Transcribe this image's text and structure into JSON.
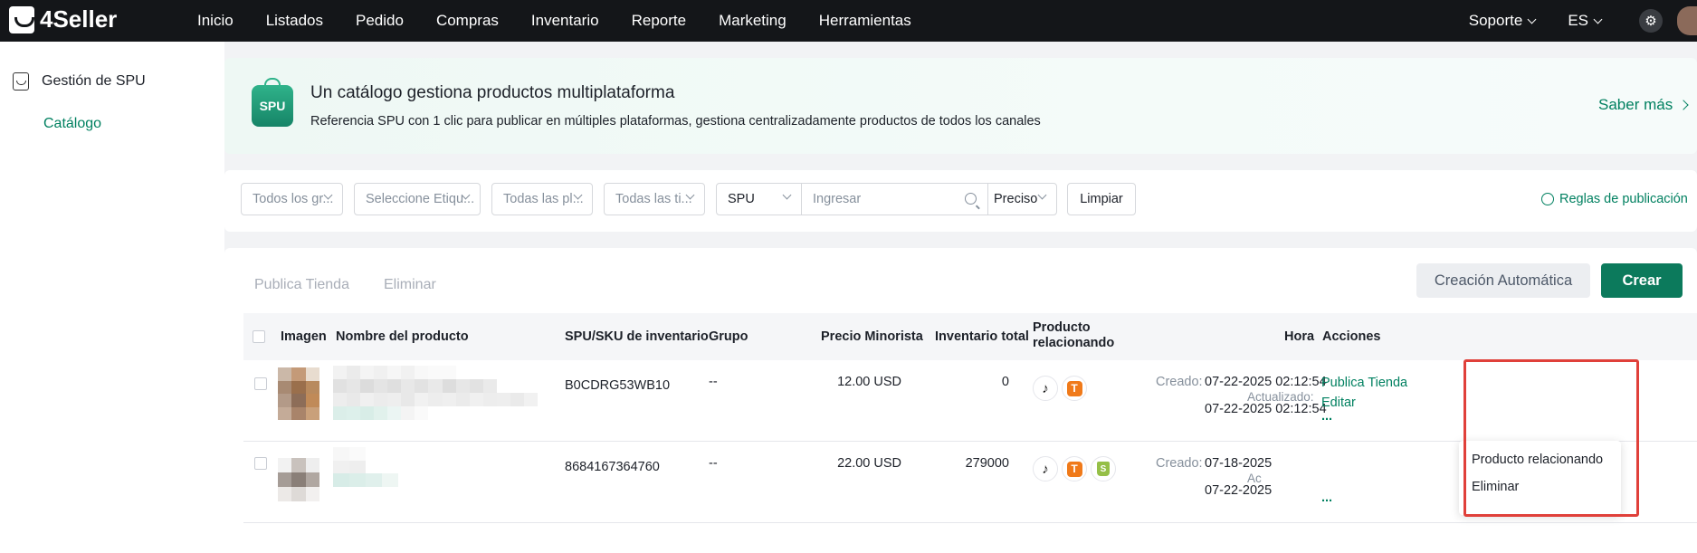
{
  "topbar": {
    "logo_text": "4Seller",
    "nav": [
      "Inicio",
      "Listados",
      "Pedido",
      "Compras",
      "Inventario",
      "Reporte",
      "Marketing",
      "Herramientas"
    ],
    "support_label": "Soporte",
    "language_label": "ES"
  },
  "sidebar": {
    "section_label": "Gestión de SPU",
    "items": [
      {
        "label": "Catálogo",
        "active": true
      }
    ]
  },
  "banner": {
    "badge": "SPU",
    "title": "Un catálogo gestiona productos multiplataforma",
    "subtitle": "Referencia SPU con 1 clic para publicar en múltiples plataformas, gestiona centralizadamente productos de todos los canales",
    "link": "Saber más"
  },
  "filters": {
    "groups_placeholder": "Todos los gr...",
    "tags_placeholder": "Seleccione Etiqu...",
    "platforms_placeholder": "Todas las pl...",
    "stores_placeholder": "Todas las ti...",
    "search_field": "SPU",
    "search_placeholder": "Ingresar",
    "match_mode": "Preciso",
    "clear_label": "Limpiar",
    "rules_label": "Reglas de publicación"
  },
  "actions": {
    "publish_store": "Publica Tienda",
    "delete": "Eliminar",
    "auto_create": "Creación Automática",
    "create": "Crear"
  },
  "table": {
    "headers": {
      "image": "Imagen",
      "name": "Nombre del producto",
      "spu_sku": "SPU/SKU de inventario",
      "group": "Grupo",
      "retail_price": "Precio Minorista",
      "total_inventory": "Inventario total",
      "related_line1": "Producto",
      "related_line2": "relacionando",
      "time": "Hora",
      "actions": "Acciones"
    },
    "rows": [
      {
        "sku": "B0CDRG53WB10",
        "group": "--",
        "price": "12.00 USD",
        "inventory": "0",
        "platforms": [
          "tiktok",
          "temu"
        ],
        "created_label": "Creado:",
        "created": "07-22-2025 02:12:54",
        "updated_label": "Actualizado:",
        "updated": "07-22-2025 02:12:54",
        "action_publish": "Publica Tienda",
        "action_edit": "Editar",
        "action_more": "..."
      },
      {
        "sku": "8684167364760",
        "group": "--",
        "price": "22.00 USD",
        "inventory": "279000",
        "platforms": [
          "tiktok",
          "temu",
          "shopify"
        ],
        "created_label": "Creado:",
        "created": "07-18-2025",
        "updated_label": "Ac",
        "updated": "07-22-2025",
        "action_more": "..."
      }
    ]
  },
  "more_menu": {
    "items": [
      "Producto relacionando",
      "Eliminar"
    ]
  },
  "icons": {
    "tiktok": "♪",
    "temu": "T",
    "shopify": "S"
  },
  "colors": {
    "brand": "#008060",
    "primary_button": "#0c7a5c",
    "highlight_box": "#e0403a",
    "topbar": "#141619"
  }
}
